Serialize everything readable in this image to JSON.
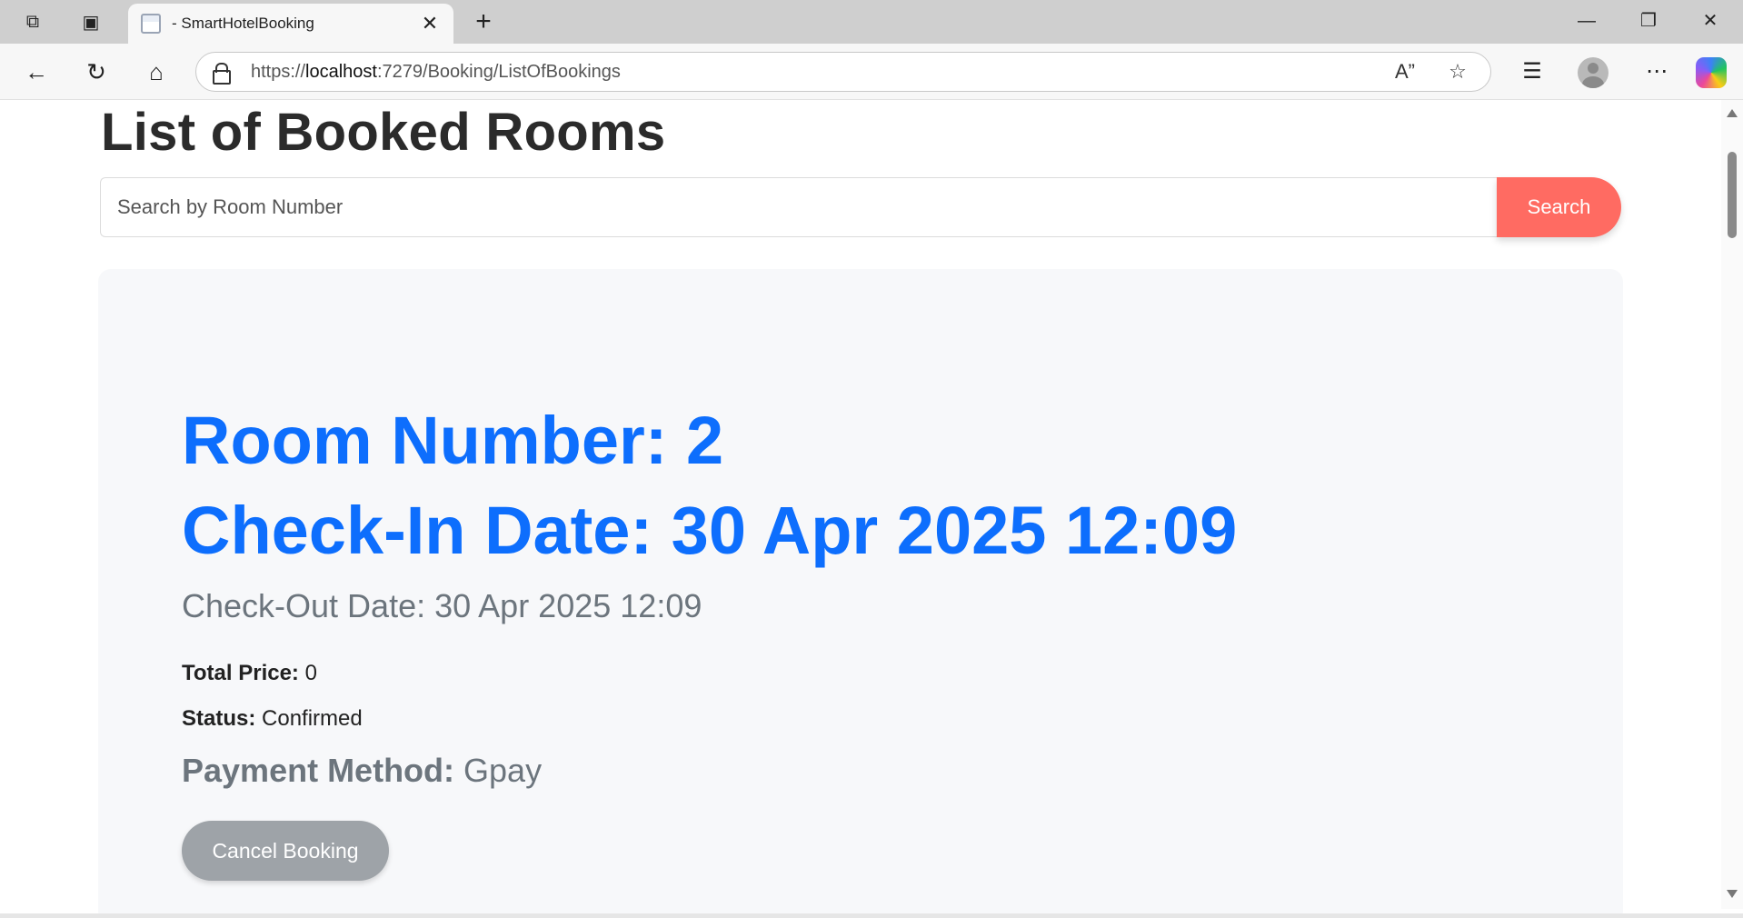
{
  "browser": {
    "tab_title": "- SmartHotelBooking",
    "url_scheme": "https://",
    "url_host": "localhost",
    "url_path": ":7279/Booking/ListOfBookings",
    "icons": {
      "workspaces": "workspaces-icon",
      "tab_actions": "tab-actions-icon",
      "close_tab": "close-icon",
      "new_tab": "plus-icon",
      "back": "back-arrow-icon",
      "refresh": "refresh-icon",
      "home": "home-icon",
      "lock": "lock-icon",
      "read_aloud": "read-aloud-icon",
      "favorite": "star-icon",
      "favorites": "favorites-icon",
      "more": "more-icon",
      "copilot": "copilot-icon"
    }
  },
  "page": {
    "title": "List of Booked Rooms",
    "search": {
      "placeholder": "Search by Room Number",
      "value": "",
      "button_label": "Search"
    },
    "booking": {
      "room_number": "Room Number: 2",
      "check_in": "Check-In Date: 30 Apr 2025 12:09",
      "check_out": "Check-Out Date: 30 Apr 2025 12:09",
      "total_price_label": "Total Price:",
      "total_price_value": " 0",
      "status_label": "Status:",
      "status_value": " Confirmed",
      "payment_label": "Payment Method:",
      "payment_value": " Gpay",
      "cancel_label": "Cancel Booking"
    }
  },
  "colors": {
    "accent_blue": "#0d6efd",
    "search_button": "#ff6b62",
    "cancel_button": "#9ea3a8",
    "muted_text": "#6c757d",
    "card_bg": "#f7f8fa"
  }
}
